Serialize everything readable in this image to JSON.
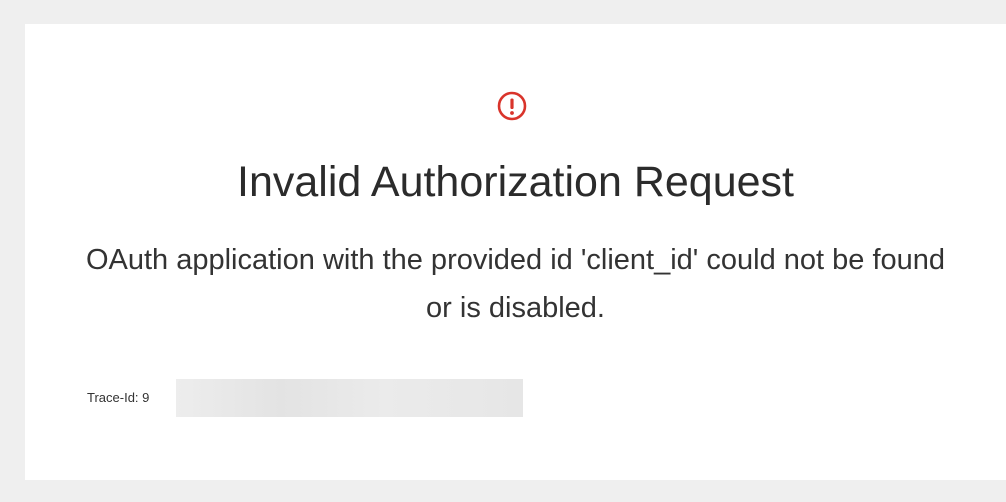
{
  "error": {
    "icon": "exclamation-circle-icon",
    "icon_color": "#d9342b",
    "title": "Invalid Authorization Request",
    "message": "OAuth application with the provided id 'client_id' could not be found or is disabled.",
    "trace_label": "Trace-Id: 9"
  }
}
